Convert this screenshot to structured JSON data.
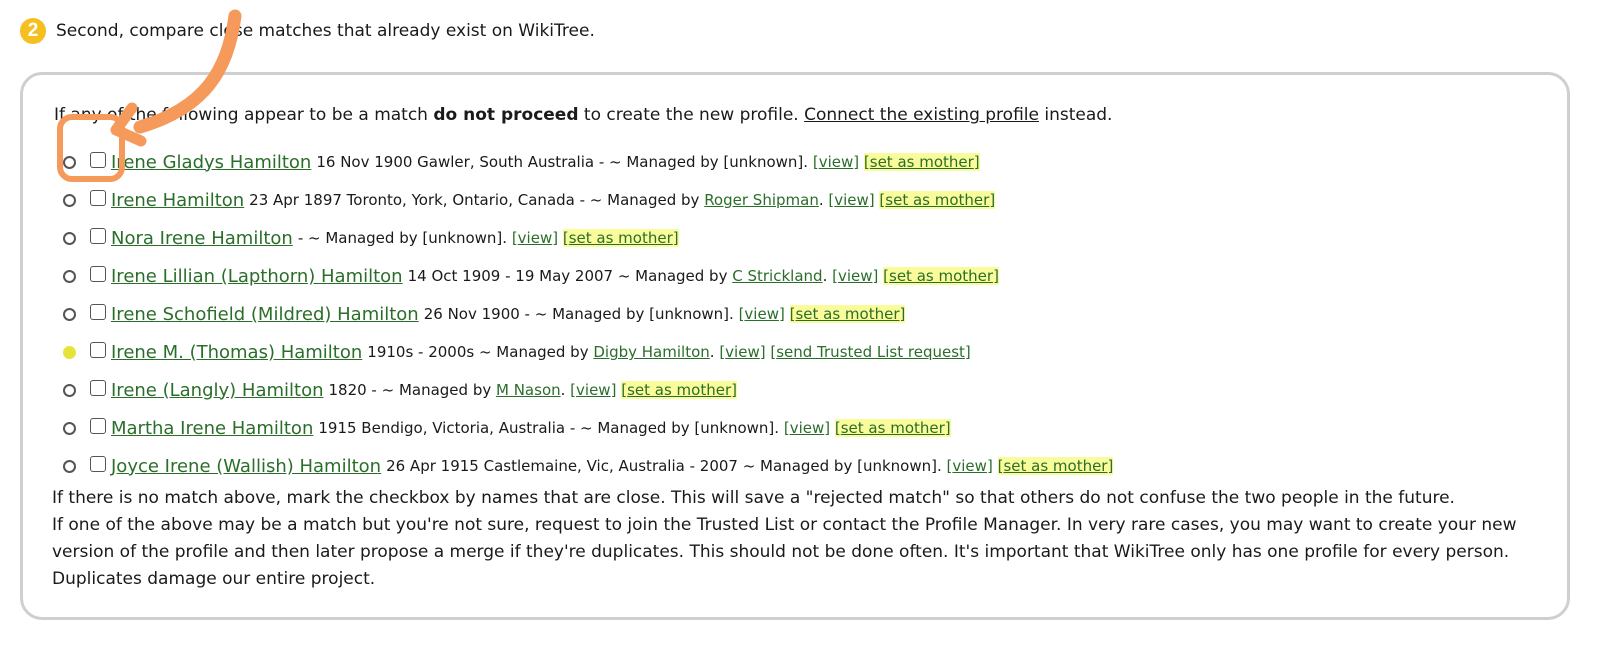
{
  "step": {
    "badge": "2",
    "text": "Second, compare close matches that already exist on WikiTree."
  },
  "intro": {
    "before": "If any of the following appear to be a match ",
    "bold": "do not proceed",
    "middle": " to create the new profile. ",
    "link": "Connect the existing profile",
    "after": " instead."
  },
  "matches": [
    {
      "name": "Irene Gladys Hamilton",
      "details": "16 Nov 1900 Gawler, South Australia - ~ Managed by",
      "manager": "[unknown]",
      "manager_is_link": false,
      "view": "view",
      "action": "set as mother",
      "radio": "outline"
    },
    {
      "name": "Irene Hamilton",
      "details": "23 Apr 1897 Toronto, York, Ontario, Canada - ~ Managed by",
      "manager": "Roger Shipman",
      "manager_is_link": true,
      "view": "view",
      "action": "set as mother",
      "radio": "outline"
    },
    {
      "name": "Nora Irene Hamilton",
      "details": "- ~ Managed by",
      "manager": "[unknown]",
      "manager_is_link": false,
      "view": "view",
      "action": "set as mother",
      "radio": "outline"
    },
    {
      "name": "Irene Lillian (Lapthorn) Hamilton",
      "details": "14 Oct 1909 - 19 May 2007 ~ Managed by",
      "manager": "C Strickland",
      "manager_is_link": true,
      "view": "view",
      "action": "set as mother",
      "radio": "outline"
    },
    {
      "name": "Irene Schofield (Mildred) Hamilton",
      "details": "26 Nov 1900 - ~ Managed by",
      "manager": "[unknown]",
      "manager_is_link": false,
      "view": "view",
      "action": "set as mother",
      "radio": "outline"
    },
    {
      "name": "Irene M. (Thomas) Hamilton",
      "details": "1910s - 2000s ~ Managed by",
      "manager": "Digby Hamilton",
      "manager_is_link": true,
      "view": "view",
      "action": "send Trusted List request",
      "radio": "yellow"
    },
    {
      "name": "Irene (Langly) Hamilton",
      "details": "1820 - ~ Managed by",
      "manager": "M Nason",
      "manager_is_link": true,
      "view": "view",
      "action": "set as mother",
      "radio": "outline"
    },
    {
      "name": "Martha Irene Hamilton",
      "details": "1915 Bendigo, Victoria, Australia - ~ Managed by",
      "manager": "[unknown]",
      "manager_is_link": false,
      "view": "view",
      "action": "set as mother",
      "radio": "outline"
    },
    {
      "name": "Joyce Irene (Wallish) Hamilton",
      "details": "26 Apr 1915 Castlemaine, Vic, Australia - 2007 ~ Managed by",
      "manager": "[unknown]",
      "manager_is_link": false,
      "view": "view",
      "action": "set as mother",
      "radio": "outline"
    }
  ],
  "footer": {
    "line1": "If there is no match above, mark the checkbox by names that are close. This will save a \"rejected match\" so that others do not confuse the two people in the future.",
    "line2": "If one of the above may be a match but you're not sure, request to join the Trusted List or contact the Profile Manager. In very rare cases, you may want to create your new version of the profile and then later propose a merge if they're duplicates. This should not be done often. It's important that WikiTree only has one profile for every person. Duplicates damage our entire project."
  },
  "colors": {
    "accent_badge": "#f4bf1f",
    "link_green": "#2a6e2a",
    "highlight": "#fafc9c",
    "annotation": "#f59a5b"
  }
}
